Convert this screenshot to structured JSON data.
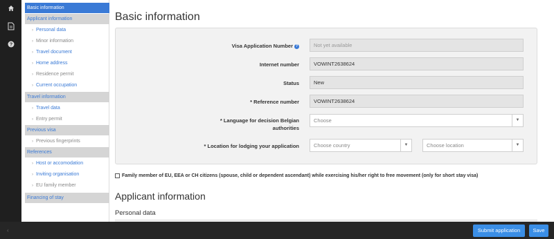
{
  "rail": {
    "icons": [
      "home-icon",
      "document-icon",
      "question-icon"
    ]
  },
  "sidebar": {
    "items": [
      {
        "label": "Basic information",
        "kind": "active"
      },
      {
        "label": "Applicant information",
        "kind": "section"
      },
      {
        "label": "Personal data",
        "kind": "link"
      },
      {
        "label": "Minor information",
        "kind": "muted"
      },
      {
        "label": "Travel document",
        "kind": "link"
      },
      {
        "label": "Home address",
        "kind": "link"
      },
      {
        "label": "Residence permit",
        "kind": "muted"
      },
      {
        "label": "Current occupation",
        "kind": "link"
      },
      {
        "label": "Travel information",
        "kind": "section"
      },
      {
        "label": "Travel data",
        "kind": "link"
      },
      {
        "label": "Entry permit",
        "kind": "muted"
      },
      {
        "label": "Previous visa",
        "kind": "section"
      },
      {
        "label": "Previous fingerprints",
        "kind": "muted"
      },
      {
        "label": "References",
        "kind": "section"
      },
      {
        "label": "Host or accomodation",
        "kind": "link"
      },
      {
        "label": "Inviting organisation",
        "kind": "link"
      },
      {
        "label": "EU family member",
        "kind": "muted"
      },
      {
        "label": "Financing of stay",
        "kind": "section"
      }
    ]
  },
  "main": {
    "title": "Basic information",
    "fields": {
      "visa_number": {
        "label": "Visa Application Number",
        "value": "Not yet available"
      },
      "internet_number": {
        "label": "Internet number",
        "value": "VOWINT2638624"
      },
      "status": {
        "label": "Status",
        "value": "New"
      },
      "reference": {
        "label": "* Reference number",
        "value": "VOWINT2638624"
      },
      "language": {
        "label_line1": "* Language for decision Belgian",
        "label_line2": "authorities",
        "value": "Choose"
      },
      "location": {
        "label": "* Location for lodging your application",
        "country": "Choose country",
        "location": "Choose location"
      }
    },
    "family_checkbox": "Family member of EU, EEA or CH citizens (spouse, child or dependent ascendant) while exercising his/her right to free movement (only for short stay visa)",
    "applicant_title": "Applicant information",
    "personal_title": "Personal data"
  },
  "footer": {
    "submit": "Submit application",
    "save": "Save"
  },
  "colors": {
    "accent": "#3a7ad6",
    "button": "#3a8ee6",
    "rail": "#1f1f1f"
  }
}
